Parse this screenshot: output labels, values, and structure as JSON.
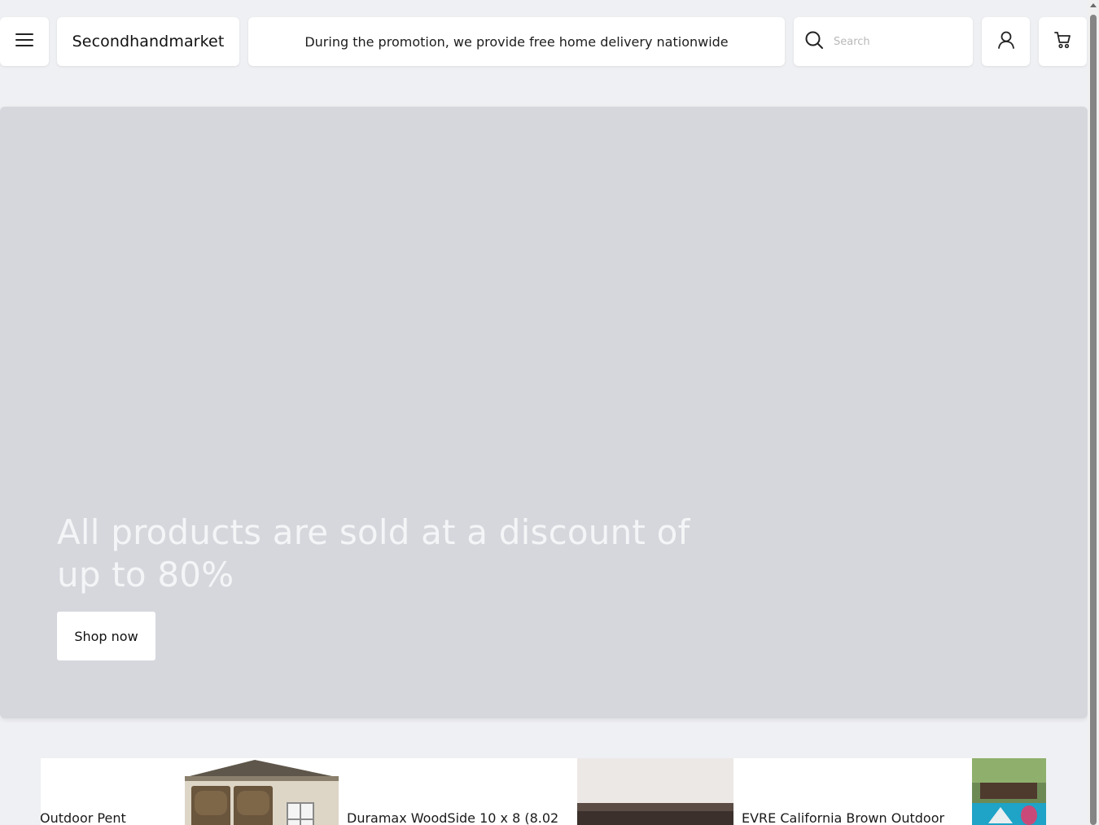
{
  "header": {
    "brand": "Secondhandmarket",
    "promo_text": "During the promotion, we provide free home delivery nationwide",
    "search_placeholder": "Search",
    "icons": {
      "menu": "menu-icon",
      "search": "search-icon",
      "account": "user-icon",
      "cart": "cart-icon"
    }
  },
  "hero": {
    "title": "All products are sold at a discount of up to 80%",
    "cta_label": "Shop now",
    "background_color": "#d5d7dc"
  },
  "products": [
    {
      "name": "Outdoor Pent"
    },
    {
      "name": "Duramax WoodSide 10 x 8 (8.02"
    },
    {
      "name": "EVRE California Brown Outdoor"
    }
  ]
}
